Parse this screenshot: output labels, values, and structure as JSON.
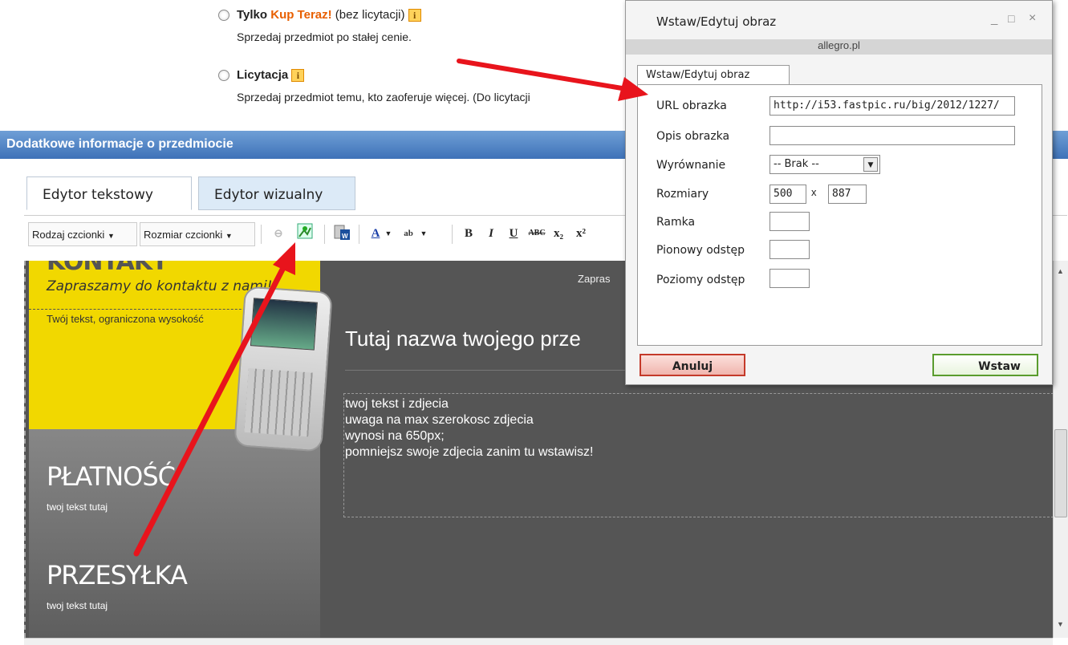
{
  "top_options": {
    "buy_now": {
      "label_pre": "Tylko ",
      "label_highlight": "Kup Teraz!",
      "label_post": " (bez licytacji)",
      "desc": "Sprzedaj przedmiot po stałej cenie."
    },
    "auction": {
      "label": "Licytacja",
      "desc": "Sprzedaj przedmiot temu, kto zaoferuje więcej. (Do licytacji"
    }
  },
  "section_title": "Dodatkowe informacje o przedmiocie",
  "tabs": [
    {
      "label": "Edytor tekstowy"
    },
    {
      "label": "Edytor wizualny"
    }
  ],
  "toolbar": {
    "font_select": "Rodzaj czcionki",
    "size_select": "Rozmiar czcionki",
    "bold": "B",
    "italic": "I",
    "underline": "U",
    "strike": "ABC",
    "sub": "x₂",
    "sup": "x²",
    "text_color": "A"
  },
  "editor": {
    "kontakt_heading": "KONTAKT",
    "kontakt_sub": "Zapraszamy do kontaktu z nami!",
    "kontakt_text": "Twój tekst, ograniczona wysokość",
    "top_right_text": "Zapras",
    "title": "Tutaj nazwa twojego prze",
    "body_lines": [
      "twoj tekst i zdjecia",
      "uwaga na max szerokosc zdjecia",
      "wynosi na 650px;",
      "pomniejsz swoje zdjecia zanim tu wstawisz!"
    ],
    "payment_heading": "PŁATNOŚĆ",
    "payment_text": "twoj tekst tutaj",
    "shipping_heading": "PRZESYŁKA",
    "shipping_text": "twoj tekst tutaj"
  },
  "dialog": {
    "title": "Wstaw/Edytuj obraz",
    "domain": "allegro.pl",
    "tab": "Wstaw/Edytuj obraz",
    "fields": {
      "url_label": "URL obrazka",
      "url_value": "http://i53.fastpic.ru/big/2012/1227/",
      "desc_label": "Opis obrazka",
      "desc_value": "",
      "align_label": "Wyrównanie",
      "align_value": "-- Brak --",
      "size_label": "Rozmiary",
      "width_value": "500",
      "height_value": "887",
      "size_sep": "x",
      "border_label": "Ramka",
      "vspace_label": "Pionowy odstęp",
      "hspace_label": "Poziomy odstęp"
    },
    "cancel_label": "Anuluj",
    "insert_label": "Wstaw",
    "minimize": "_",
    "maximize": "□",
    "close": "×"
  },
  "colors": {
    "accent_blue": "#4a7cc0",
    "arrow_red": "#e8141c",
    "editor_bg": "#555555",
    "yellow": "#f1d800"
  }
}
